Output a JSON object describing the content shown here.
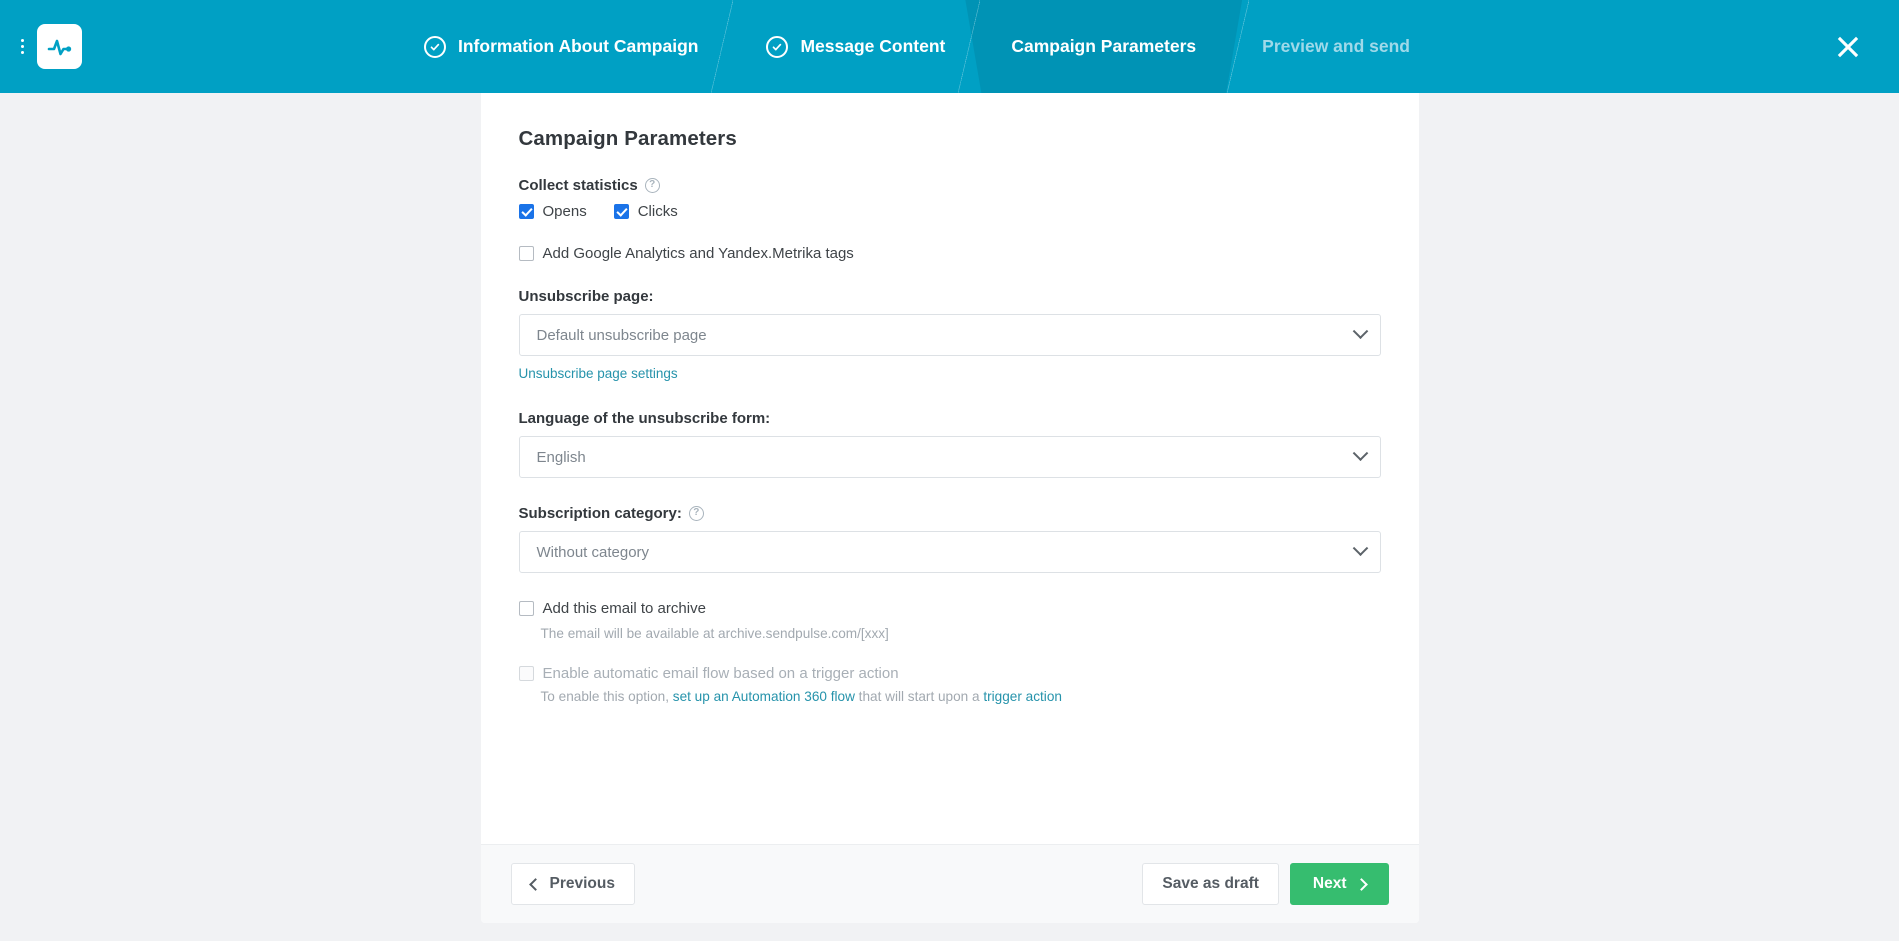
{
  "header": {
    "logo_icon": "pulse-activity-icon",
    "menu_icon": "kebab-menu-icon",
    "close_icon": "close-icon",
    "steps": [
      {
        "label": "Information About Campaign",
        "state": "completed"
      },
      {
        "label": "Message Content",
        "state": "completed"
      },
      {
        "label": "Campaign Parameters",
        "state": "active"
      },
      {
        "label": "Preview and send",
        "state": "pending"
      }
    ],
    "colors": {
      "bar": "#00a0c4",
      "active_tab": "#0093b5",
      "pending_text": "#9fd9e9"
    }
  },
  "main": {
    "title": "Campaign Parameters",
    "collect_statistics": {
      "label": "Collect statistics",
      "help_icon": "question-mark-icon",
      "options": [
        {
          "label": "Opens",
          "checked": true
        },
        {
          "label": "Clicks",
          "checked": true
        }
      ]
    },
    "analytics_tags": {
      "label": "Add Google Analytics and Yandex.Metrika tags",
      "checked": false
    },
    "unsubscribe_page": {
      "label": "Unsubscribe page:",
      "value": "Default unsubscribe page",
      "link": "Unsubscribe page settings",
      "chevron_icon": "chevron-down-icon"
    },
    "unsubscribe_language": {
      "label": "Language of the unsubscribe form:",
      "value": "English",
      "chevron_icon": "chevron-down-icon"
    },
    "subscription_category": {
      "label": "Subscription category:",
      "help_icon": "question-mark-icon",
      "value": "Without category",
      "chevron_icon": "chevron-down-icon"
    },
    "archive": {
      "label": "Add this email to archive",
      "checked": false,
      "hint": "The email will be available at archive.sendpulse.com/[xxx]"
    },
    "trigger_flow": {
      "label": "Enable automatic email flow based on a trigger action",
      "checked": false,
      "disabled": true,
      "hint_prefix": "To enable this option, ",
      "hint_link_1": "set up an Automation 360 flow",
      "hint_middle": " that will start upon a ",
      "hint_link_2": "trigger action"
    }
  },
  "footer": {
    "previous_label": "Previous",
    "previous_icon": "chevron-left-icon",
    "save_draft_label": "Save as draft",
    "next_label": "Next",
    "next_icon": "chevron-right-icon",
    "accent_green": "#36bd6f"
  }
}
